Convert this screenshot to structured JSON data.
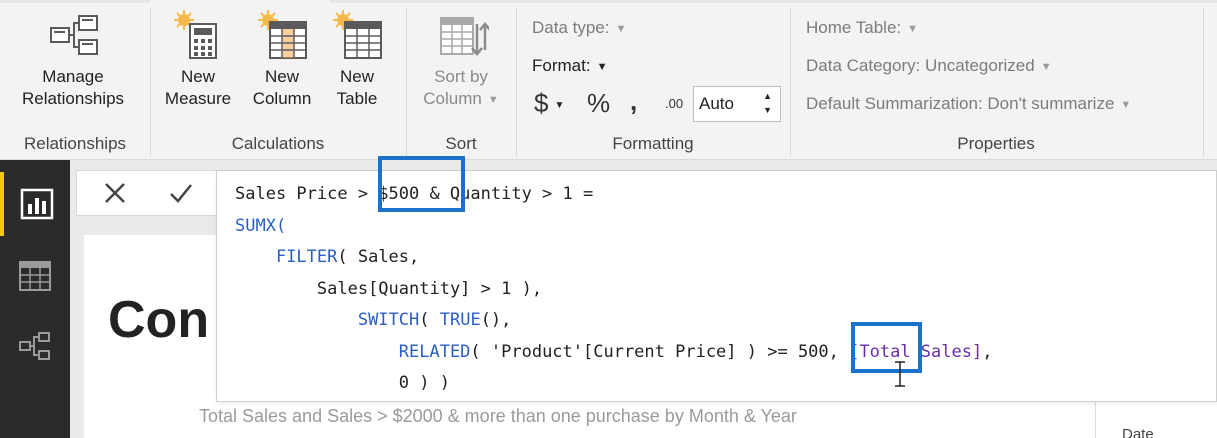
{
  "ribbon": {
    "relationships": {
      "manage_label_1": "Manage",
      "manage_label_2": "Relationships",
      "group_label": "Relationships"
    },
    "calculations": {
      "new_measure_1": "New",
      "new_measure_2": "Measure",
      "new_column_1": "New",
      "new_column_2": "Column",
      "new_table_1": "New",
      "new_table_2": "Table",
      "group_label": "Calculations"
    },
    "sort": {
      "sort_label_1": "Sort by",
      "sort_label_2": "Column",
      "group_label": "Sort"
    },
    "formatting": {
      "data_type_label": "Data type:",
      "format_label": "Format:",
      "currency_symbol": "$",
      "percent_symbol": "%",
      "comma_symbol": ",",
      "decimal_symbol": ".00",
      "auto_value": "Auto",
      "group_label": "Formatting"
    },
    "properties": {
      "home_table_label": "Home Table:",
      "data_category_label": "Data Category: Uncategorized",
      "default_summarization_label": "Default Summarization: Don't summarize",
      "group_label": "Properties"
    }
  },
  "formula": {
    "line1": "Sales Price > $500 & Quantity > 1 =",
    "line2_kw": "SUMX",
    "line2_paren": "(",
    "line3_kw": "FILTER",
    "line3_rest": "( Sales,",
    "line4": "Sales[Quantity] > 1 ),",
    "line5_kw1": "SWITCH",
    "line5_mid": "( ",
    "line5_kw2": "TRUE",
    "line5_rest": "(),",
    "line6_kw": "RELATED",
    "line6_rest": "( 'Product'[Current Price] ) >= 500, ",
    "line6_measure": "[Total Sales]",
    "line6_end": ",",
    "line7": "0 ) )"
  },
  "canvas": {
    "page_title": "Con",
    "visual_subtitle": "Total Sales and Sales > $2000 & more than one purchase by Month & Year",
    "right_panel_label": "Date"
  },
  "colors": {
    "accent_yellow": "#f2c811",
    "highlight_blue": "#1a73c8",
    "dax_keyword": "#2b5ec7",
    "dax_measure": "#6a2cae"
  }
}
